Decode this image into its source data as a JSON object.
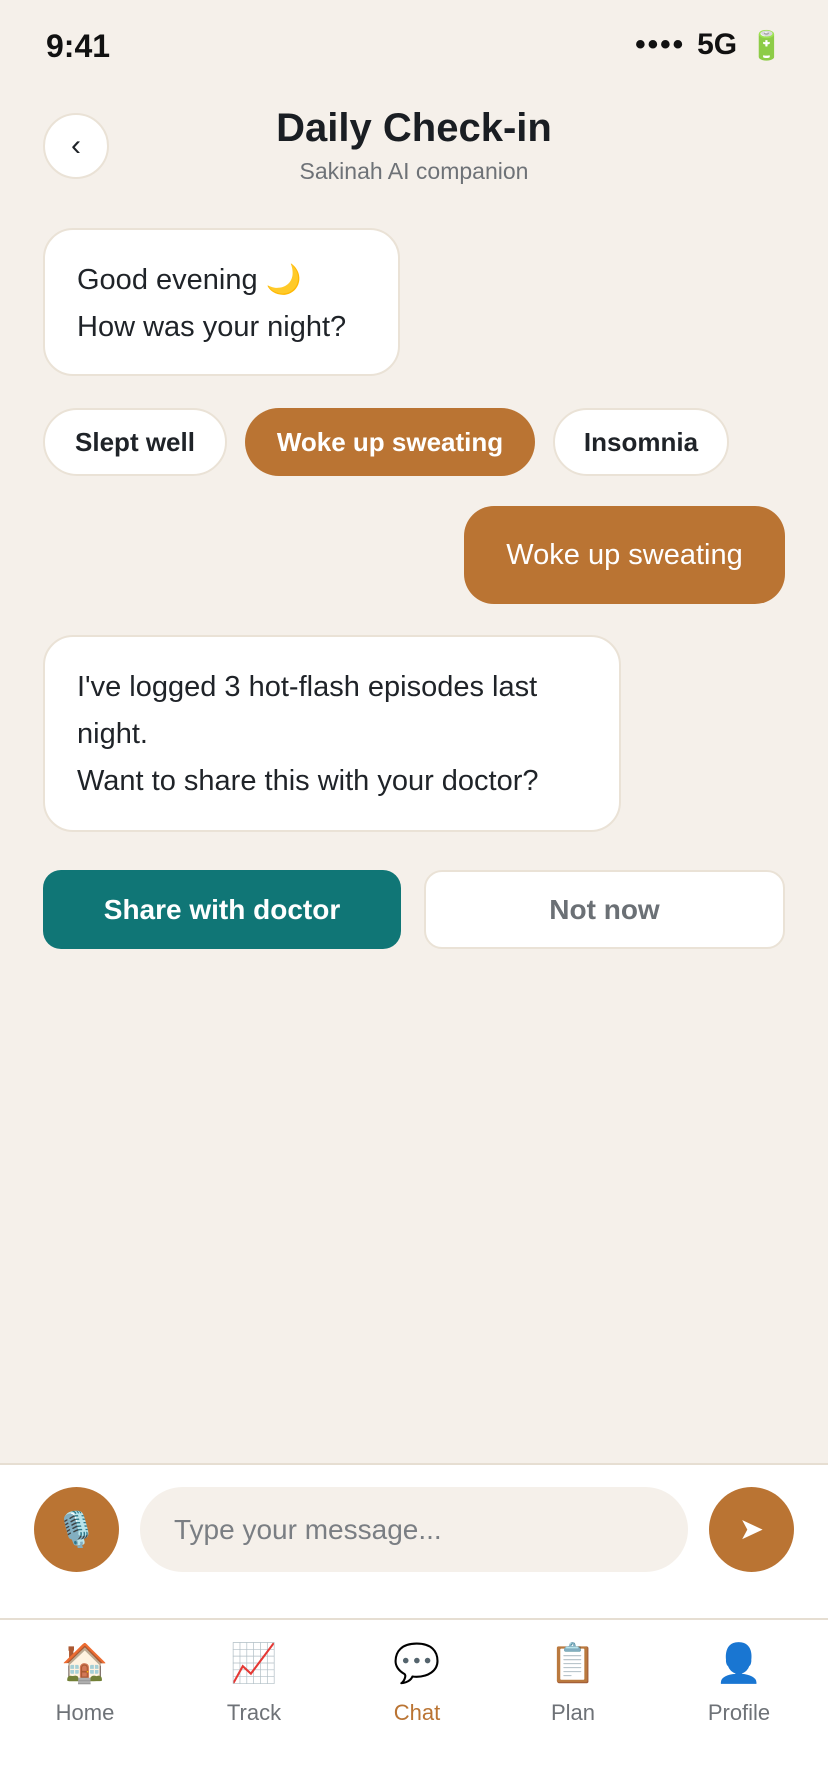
{
  "status_bar": {
    "time": "9:41",
    "signal": "••••",
    "network": "5G",
    "battery_icon": "🔋"
  },
  "header": {
    "back_icon": "‹",
    "title": "Daily Check-in",
    "subtitle": "Sakinah AI companion"
  },
  "messages": [
    {
      "from": "bot",
      "lines": [
        "Good evening 🌙",
        "How was your night?"
      ]
    },
    {
      "from": "user",
      "text": "Woke up sweating"
    },
    {
      "from": "bot",
      "lines": [
        "I've logged 3 hot-flash episodes last",
        "night.",
        "Want to share this with your doctor?"
      ]
    }
  ],
  "quick_replies": [
    {
      "label": "Slept well",
      "selected": false
    },
    {
      "label": "Woke up sweating",
      "selected": true
    },
    {
      "label": "Insomnia",
      "selected": false
    }
  ],
  "actions": {
    "share_label": "Share with doctor",
    "not_now_label": "Not now"
  },
  "composer": {
    "mic_icon": "🎙️",
    "placeholder": "Type your message...",
    "value": "",
    "send_icon": "➤"
  },
  "tabs": [
    {
      "label": "Home",
      "icon": "🏠",
      "active": false
    },
    {
      "label": "Track",
      "icon": "📈",
      "active": false
    },
    {
      "label": "Chat",
      "icon": "💬",
      "active": true
    },
    {
      "label": "Plan",
      "icon": "📋",
      "active": false
    },
    {
      "label": "Profile",
      "icon": "👤",
      "active": false
    }
  ],
  "colors": {
    "background": "#F5F0EA",
    "accent": "#BA7433",
    "primary_action": "#107676",
    "text": "#1F2328",
    "muted": "#6E7277"
  }
}
